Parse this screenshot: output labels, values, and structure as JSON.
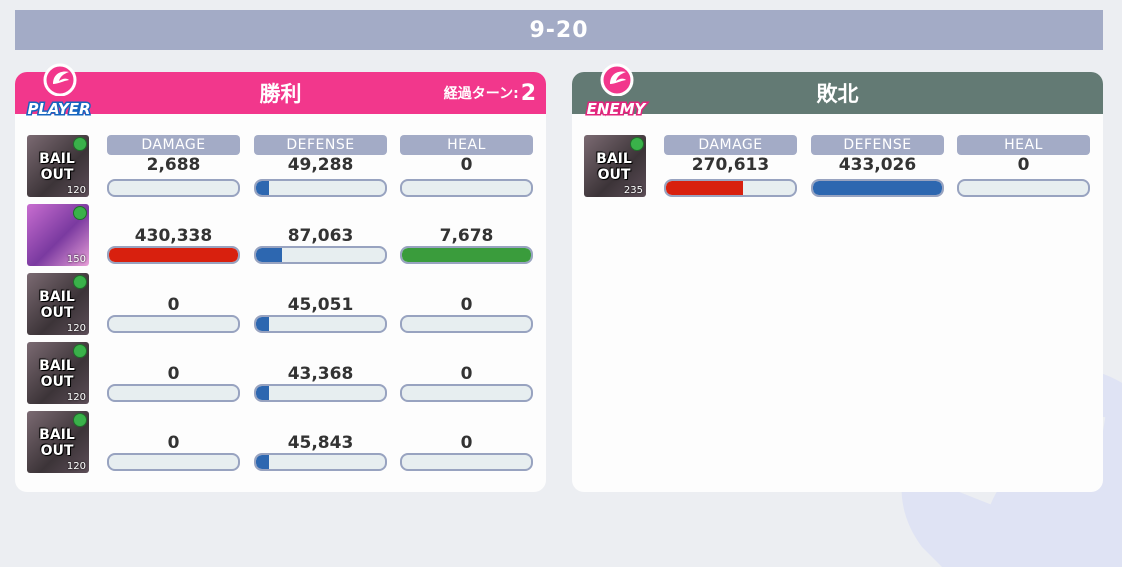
{
  "stage": "9-20",
  "colors": {
    "damage": "#d8200e",
    "defense": "#2d67b0",
    "heal": "#3a9c3c",
    "player_header": "#f2378c",
    "enemy_header": "#637a74"
  },
  "player": {
    "badge": "PLAYER",
    "result": "勝利",
    "turns_label": "経過ターン:",
    "turns": "2",
    "labels": {
      "damage": "DAMAGE",
      "defense": "DEFENSE",
      "heal": "HEAL"
    },
    "units": [
      {
        "status": "BAIL OUT",
        "level": "120",
        "damage": "2,688",
        "defense": "49,288",
        "heal": "0",
        "damage_ratio": 0.0,
        "defense_ratio": 0.1,
        "heal_ratio": 0.0,
        "icon": "bail-out-portrait"
      },
      {
        "status": "",
        "level": "150",
        "damage": "430,338",
        "defense": "87,063",
        "heal": "7,678",
        "damage_ratio": 1.0,
        "defense_ratio": 0.2,
        "heal_ratio": 1.0,
        "icon": "character-portrait"
      },
      {
        "status": "BAIL OUT",
        "level": "120",
        "damage": "0",
        "defense": "45,051",
        "heal": "0",
        "damage_ratio": 0.0,
        "defense_ratio": 0.1,
        "heal_ratio": 0.0,
        "icon": "bail-out-portrait"
      },
      {
        "status": "BAIL OUT",
        "level": "120",
        "damage": "0",
        "defense": "43,368",
        "heal": "0",
        "damage_ratio": 0.0,
        "defense_ratio": 0.1,
        "heal_ratio": 0.0,
        "icon": "bail-out-portrait"
      },
      {
        "status": "BAIL OUT",
        "level": "120",
        "damage": "0",
        "defense": "45,843",
        "heal": "0",
        "damage_ratio": 0.0,
        "defense_ratio": 0.1,
        "heal_ratio": 0.0,
        "icon": "bail-out-portrait"
      }
    ]
  },
  "enemy": {
    "badge": "ENEMY",
    "result": "敗北",
    "labels": {
      "damage": "DAMAGE",
      "defense": "DEFENSE",
      "heal": "HEAL"
    },
    "units": [
      {
        "status": "BAIL OUT",
        "level": "235",
        "damage": "270,613",
        "defense": "433,026",
        "heal": "0",
        "damage_ratio": 0.6,
        "defense_ratio": 1.0,
        "heal_ratio": 0.0,
        "icon": "bail-out-portrait"
      }
    ]
  }
}
